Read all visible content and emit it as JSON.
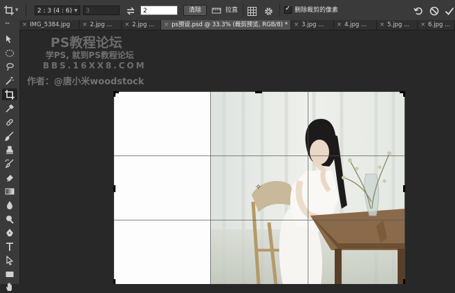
{
  "options_bar": {
    "ratio_preset": "2 : 3 (4 : 6)",
    "width_value": "3",
    "height_value": "2",
    "clear_label": "清除",
    "straighten_label": "拉直",
    "delete_cropped_label": "删除裁剪的像素",
    "delete_cropped_checked": true
  },
  "tabs": [
    {
      "label": "IMG_5384.jpg",
      "active": false
    },
    {
      "label": "2.jpg ...",
      "active": false
    },
    {
      "label": "2.jpg ...",
      "active": false
    },
    {
      "label": "ps预设.psd @ 33.3% (裁剪预览, RGB/8) *",
      "active": true
    },
    {
      "label": "3.jpg ...",
      "active": false
    },
    {
      "label": "4.jpg ...",
      "active": false
    },
    {
      "label": "5.jpg ...",
      "active": false
    },
    {
      "label": "6.jpg ...",
      "active": false
    }
  ],
  "watermark": {
    "title": "PS教程论坛",
    "subtitle": "学PS, 就到PS教程论坛",
    "url": "BBS.16XX8.COM",
    "author": "作者：@唐小米woodstock"
  },
  "tools": [
    "move-icon",
    "marquee-icon",
    "lasso-icon",
    "magic-wand-icon",
    "crop-icon",
    "eyedropper-icon",
    "healing-brush-icon",
    "brush-icon",
    "clone-stamp-icon",
    "history-brush-icon",
    "eraser-icon",
    "gradient-icon",
    "blur-icon",
    "dodge-icon",
    "pen-icon",
    "type-icon",
    "path-selection-icon",
    "rectangle-icon",
    "hand-icon"
  ],
  "colors": {
    "ui_background": "#282828",
    "panel": "#3a3a3a",
    "active_tab": "#505050"
  }
}
